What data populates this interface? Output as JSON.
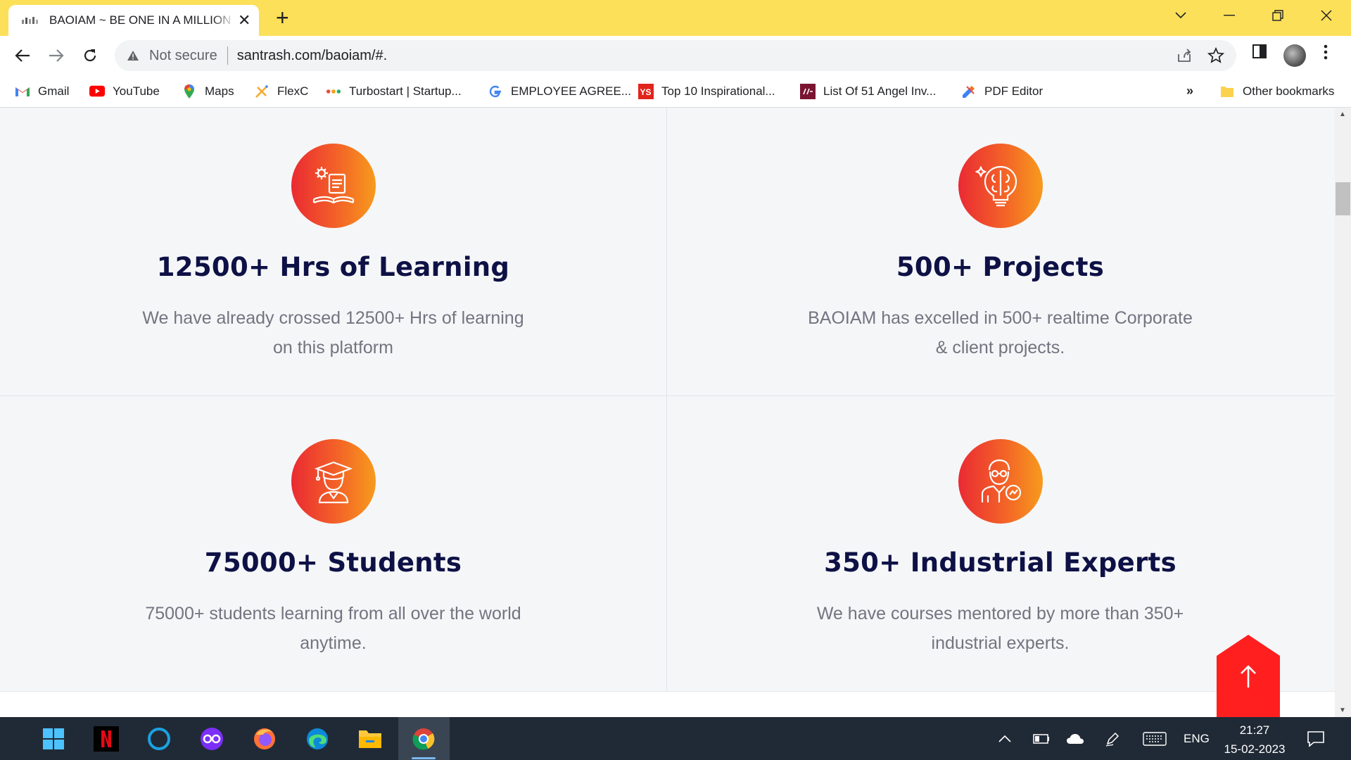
{
  "browser": {
    "tab": {
      "title": "BAOIAM ~ BE ONE IN A MILLION"
    },
    "address": {
      "security_label": "Not secure",
      "url": "santrash.com/baoiam/#."
    },
    "bookmarks": [
      {
        "label": "Gmail",
        "icon": "gmail-icon"
      },
      {
        "label": "YouTube",
        "icon": "youtube-icon"
      },
      {
        "label": "Maps",
        "icon": "maps-icon"
      },
      {
        "label": "FlexC",
        "icon": "flexc-icon"
      },
      {
        "label": "Turbostart | Startup...",
        "icon": "turbostart-icon"
      },
      {
        "label": "EMPLOYEE AGREE...",
        "icon": "google-icon"
      },
      {
        "label": "Top 10 Inspirational...",
        "icon": "yourstory-icon"
      },
      {
        "label": "List Of 51 Angel Inv...",
        "icon": "inc42-icon"
      },
      {
        "label": "PDF Editor",
        "icon": "pdf-editor-icon"
      }
    ],
    "overflow_label": "»",
    "other_bookmarks": "Other bookmarks"
  },
  "features": [
    {
      "title": "12500+ Hrs of Learning",
      "desc": "We have already crossed 12500+ Hrs of learning on this platform",
      "icon": "learning-book-icon"
    },
    {
      "title": "500+ Projects",
      "desc": "BAOIAM has excelled in 500+ realtime Corporate & client projects.",
      "icon": "brain-bulb-icon"
    },
    {
      "title": "75000+ Students",
      "desc": "75000+ students learning from all over the world anytime.",
      "icon": "graduate-icon"
    },
    {
      "title": "350+ Industrial Experts",
      "desc": "We have courses mentored by more than 350+ industrial experts.",
      "icon": "expert-icon"
    }
  ],
  "taskbar": {
    "language": "ENG",
    "time": "21:27",
    "date": "15-02-2023"
  },
  "colors": {
    "tabbar": "#fde05a",
    "accent_gradient_start": "#ea2a33",
    "accent_gradient_end": "#f79b1d",
    "title": "#0e1145",
    "description": "#727480",
    "scroll_top_button": "#ff1f1f",
    "taskbar": "#202a36"
  }
}
